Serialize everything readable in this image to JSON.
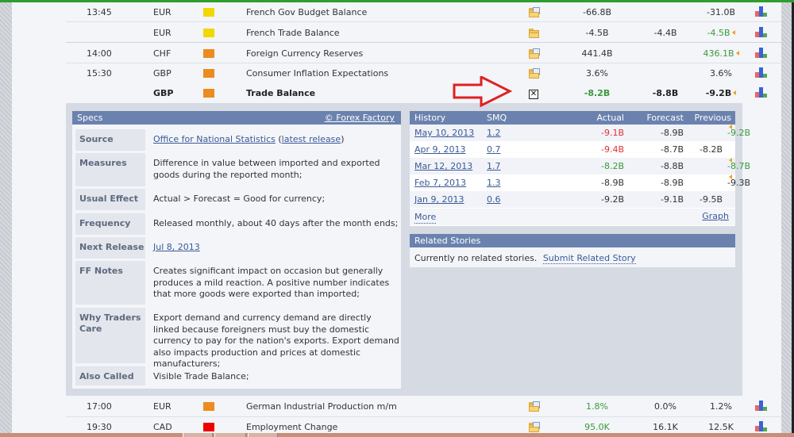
{
  "calendar": {
    "rows_top": [
      {
        "time": "13:45",
        "currency": "EUR",
        "impact": "low",
        "impact_color": "#f0d800",
        "event": "French Gov Budget Balance",
        "detail_icon": "folder-doc-icon",
        "actual": "-66.8B",
        "forecast": "",
        "previous": "-31.0B",
        "previous_revised": false,
        "bold": false
      },
      {
        "time": "",
        "currency": "EUR",
        "impact": "low",
        "impact_color": "#f0d800",
        "event": "French Trade Balance",
        "detail_icon": "folder-icon",
        "actual": "-4.5B",
        "forecast": "-4.4B",
        "previous": "-4.5B",
        "previous_revised": true,
        "previous_color": "green",
        "bold": false
      },
      {
        "time": "14:00",
        "currency": "CHF",
        "impact": "medium",
        "impact_color": "#ec8b1f",
        "event": "Foreign Currency Reserves",
        "detail_icon": "folder-doc-icon",
        "actual": "441.4B",
        "forecast": "",
        "previous": "436.1B",
        "previous_revised": true,
        "previous_color": "green",
        "bold": false
      },
      {
        "time": "15:30",
        "currency": "GBP",
        "impact": "medium",
        "impact_color": "#ec8b1f",
        "event": "Consumer Inflation Expectations",
        "detail_icon": "folder-doc-icon",
        "actual": "3.6%",
        "forecast": "",
        "previous": "3.6%",
        "previous_revised": false,
        "bold": false
      },
      {
        "time": "",
        "currency": "GBP",
        "impact": "medium",
        "impact_color": "#ec8b1f",
        "event": "Trade Balance",
        "detail_icon": "close-box-icon",
        "actual": "-8.2B",
        "actual_color": "green",
        "forecast": "-8.8B",
        "previous": "-9.2B",
        "previous_revised": true,
        "bold": true
      }
    ],
    "rows_bottom": [
      {
        "time": "17:00",
        "currency": "EUR",
        "impact": "medium",
        "impact_color": "#ec8b1f",
        "event": "German Industrial Production m/m",
        "detail_icon": "folder-doc-icon",
        "actual": "1.8%",
        "actual_color": "green",
        "forecast": "0.0%",
        "previous": "1.2%"
      },
      {
        "time": "19:30",
        "currency": "CAD",
        "impact": "high",
        "impact_color": "#e00000",
        "event": "Employment Change",
        "detail_icon": "folder-doc-icon",
        "actual": "95.0K",
        "actual_color": "green",
        "forecast": "16.1K",
        "previous": "12.5K"
      }
    ]
  },
  "specs": {
    "title": "Specs",
    "copyright_link": "© Forex Factory",
    "source_label": "Source",
    "source_link": "Office for National Statistics",
    "source_open": "(",
    "source_latest": "latest release",
    "source_close": ")",
    "measures_label": "Measures",
    "measures_value": "Difference in value between imported and exported goods during the reported month;",
    "usual_effect_label": "Usual Effect",
    "usual_effect_value": "Actual > Forecast = Good for currency;",
    "frequency_label": "Frequency",
    "frequency_value": "Released monthly, about 40 days after the month ends;",
    "next_release_label": "Next Release",
    "next_release_value": "Jul 8, 2013",
    "ff_notes_label": "FF Notes",
    "ff_notes_value": "Creates significant impact on occasion but generally produces a mild reaction. A positive number indicates that more goods were exported than imported;",
    "why_label": "Why Traders Care",
    "why_value": "Export demand and currency demand are directly linked because foreigners must buy the domestic currency to pay for the nation's exports. Export demand also impacts production and prices at domestic manufacturers;",
    "also_called_label": "Also Called",
    "also_called_value": "Visible Trade Balance;"
  },
  "history": {
    "headers": {
      "history": "History",
      "smq": "SMQ",
      "actual": "Actual",
      "forecast": "Forecast",
      "previous": "Previous"
    },
    "rows": [
      {
        "date": "May 10, 2013",
        "smq": "1.2",
        "actual": "-9.1B",
        "actual_color": "red",
        "forecast": "-8.9B",
        "previous": "-9.2B",
        "previous_color": "green",
        "previous_revised": true
      },
      {
        "date": "Apr 9, 2013",
        "smq": "0.7",
        "actual": "-9.4B",
        "actual_color": "red",
        "forecast": "-8.7B",
        "previous": "-8.2B",
        "previous_revised": false
      },
      {
        "date": "Mar 12, 2013",
        "smq": "1.7",
        "actual": "-8.2B",
        "actual_color": "green",
        "forecast": "-8.8B",
        "previous": "-8.7B",
        "previous_color": "green",
        "previous_revised": true
      },
      {
        "date": "Feb 7, 2013",
        "smq": "1.3",
        "actual": "-8.9B",
        "forecast": "-8.9B",
        "previous": "-9.3B",
        "previous_revised": true
      },
      {
        "date": "Jan 9, 2013",
        "smq": "0.6",
        "actual": "-9.2B",
        "forecast": "-9.1B",
        "previous": "-9.5B",
        "previous_revised": false
      }
    ],
    "more_label": "More",
    "graph_label": "Graph"
  },
  "related": {
    "title": "Related Stories",
    "empty_text": "Currently no related stories.",
    "submit_link": "Submit Related Story"
  },
  "annotation": {
    "arrow_color": "#e02020"
  }
}
